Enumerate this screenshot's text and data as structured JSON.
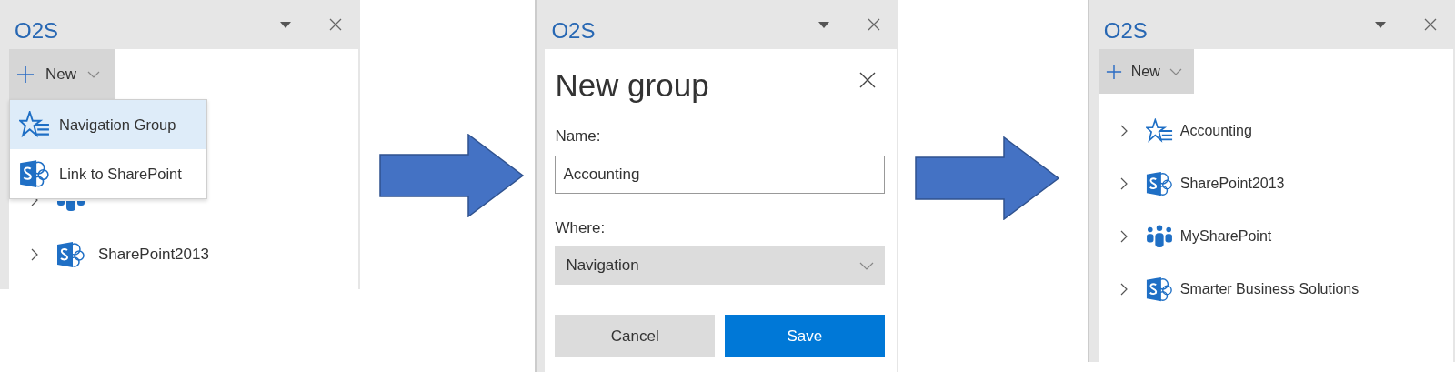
{
  "menu_panel": {
    "title": "O2S",
    "new_button": "New",
    "menu": [
      {
        "label": "Navigation Group",
        "kind": "star",
        "selected": true
      },
      {
        "label": "Link to SharePoint",
        "kind": "sharepoint",
        "selected": false
      }
    ],
    "tree": [
      {
        "kind": "people"
      },
      {
        "label": "SharePoint2013",
        "kind": "sharepoint"
      }
    ]
  },
  "dialog_panel": {
    "title": "O2S",
    "heading": "New group",
    "name_label": "Name:",
    "name_value": "Accounting",
    "where_label": "Where:",
    "where_value": "Navigation",
    "cancel": "Cancel",
    "save": "Save"
  },
  "result_panel": {
    "title": "O2S",
    "new_button": "New",
    "tree": [
      {
        "label": "Accounting",
        "kind": "star"
      },
      {
        "label": "SharePoint2013",
        "kind": "sharepoint"
      },
      {
        "label": "MySharePoint",
        "kind": "people"
      },
      {
        "label": "Smarter Business Solutions",
        "kind": "sharepoint"
      }
    ]
  }
}
